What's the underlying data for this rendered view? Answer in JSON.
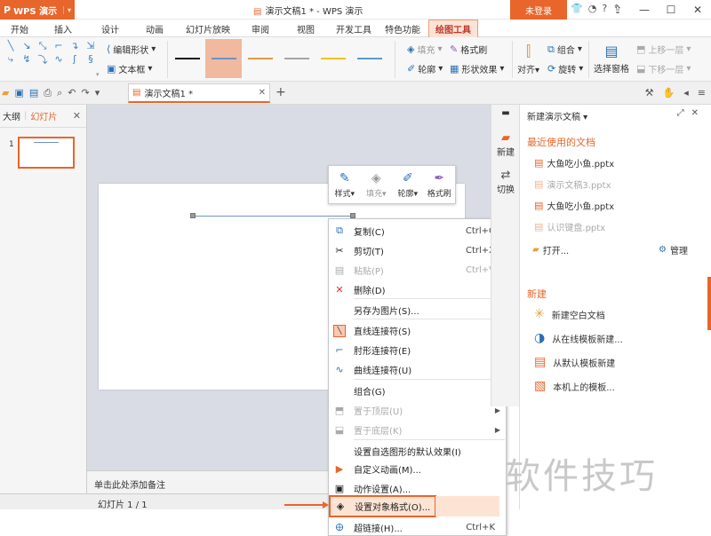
{
  "titlebar": {
    "app_name": "WPS 演示",
    "doc_title": "演示文稿1 * - WPS 演示",
    "login": "未登录"
  },
  "menu": {
    "tabs": [
      "开始",
      "插入",
      "设计",
      "动画",
      "幻灯片放映",
      "审阅",
      "视图",
      "开发工具",
      "特色功能",
      "绘图工具"
    ],
    "active": "绘图工具"
  },
  "ribbon": {
    "edit_shape": "编辑形状",
    "text_box": "文本框",
    "fill": "填充",
    "format_brush": "格式刷",
    "outline": "轮廓",
    "shape_effect": "形状效果",
    "align": "对齐",
    "group": "组合",
    "rotate": "旋转",
    "selection_pane": "选择窗格",
    "bring_forward": "上移一层",
    "send_backward": "下移一层",
    "line_colors": [
      "#1a1a1a",
      "#6d93c5",
      "#e39a48",
      "#a5a5a5",
      "#f0c419",
      "#5b9bd5"
    ]
  },
  "quickbar": {
    "doc_tab": "演示文稿1 *"
  },
  "leftpane": {
    "tab_outline": "大纲",
    "tab_slides": "幻灯片",
    "slide_number": "1"
  },
  "minibar": {
    "style": "样式",
    "fill": "填充",
    "outline": "轮廓",
    "format_brush": "格式刷"
  },
  "context_menu": {
    "copy": "复制(C)",
    "copy_sc": "Ctrl+C",
    "cut": "剪切(T)",
    "cut_sc": "Ctrl+X",
    "paste": "粘贴(P)",
    "paste_sc": "Ctrl+V",
    "delete": "删除(D)",
    "save_as_picture": "另存为图片(S)...",
    "straight_connector": "直线连接符(S)",
    "elbow_connector": "肘形连接符(E)",
    "curved_connector": "曲线连接符(U)",
    "group": "组合(G)",
    "bring_to_front": "置于顶层(U)",
    "send_to_back": "置于底层(K)",
    "set_default_effect": "设置自选图形的默认效果(I)",
    "custom_animation": "自定义动画(M)...",
    "action_settings": "动作设置(A)...",
    "format_object": "设置对象格式(O)...",
    "hyperlink": "超链接(H)...",
    "hyperlink_sc": "Ctrl+K"
  },
  "notes_placeholder": "单击此处添加备注",
  "status": {
    "slide_count": "幻灯片 1 / 1"
  },
  "sidestrip": {
    "new": "新建",
    "switch": "切换"
  },
  "taskpane": {
    "header": "新建演示文稿",
    "recent_title": "最近使用的文档",
    "recent_files": [
      {
        "name": "大鱼吃小鱼.pptx",
        "dim": false
      },
      {
        "name": "演示文稿3.pptx",
        "dim": true
      },
      {
        "name": "大鱼吃小鱼.pptx",
        "dim": false
      },
      {
        "name": "认识键盘.pptx",
        "dim": true
      }
    ],
    "open": "打开...",
    "manage": "管理",
    "new_title": "新建",
    "new_items": [
      "新建空白文档",
      "从在线模板新建...",
      "从默认模板新建",
      "本机上的模板..."
    ]
  },
  "watermark": "软件技巧"
}
